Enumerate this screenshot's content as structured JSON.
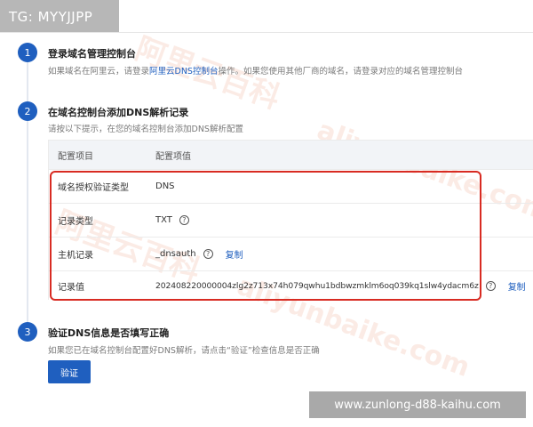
{
  "tag": {
    "text": "TG: MYYJJPP"
  },
  "steps": [
    {
      "num": "1",
      "title": "登录域名管理控制台",
      "desc_pre": "如果域名在阿里云，请登录",
      "desc_link": "阿里云DNS控制台",
      "desc_post": "操作。如果您使用其他厂商的域名，请登录对应的域名管理控制台"
    },
    {
      "num": "2",
      "title": "在域名控制台添加DNS解析记录",
      "desc": "请按以下提示，在您的域名控制台添加DNS解析配置"
    },
    {
      "num": "3",
      "title": "验证DNS信息是否填写正确",
      "desc": "如果您已在域名控制台配置好DNS解析，请点击“验证”检查信息是否正确"
    }
  ],
  "table": {
    "headers": [
      "配置项目",
      "配置项值"
    ],
    "rows": [
      {
        "label": "域名授权验证类型",
        "value": "DNS"
      },
      {
        "label": "记录类型",
        "value": "TXT"
      },
      {
        "label": "主机记录",
        "value": "_dnsauth",
        "copy": "复制"
      },
      {
        "label": "记录值",
        "value": "202408220000004zlg2z713x74h079qwhu1bdbwzmklm6oq039kq1slw4ydacm6z",
        "copy": "复制"
      }
    ]
  },
  "verify_button": "验证",
  "watermark_url": "www.zunlong-d88-kaihu.com",
  "watermark_bg": [
    "阿里云百科",
    "aliyunbaike.com",
    "阿里云百科",
    "aliyunbaike.com"
  ],
  "colors": {
    "accent": "#1f5fbf",
    "highlight": "#d82b22"
  }
}
